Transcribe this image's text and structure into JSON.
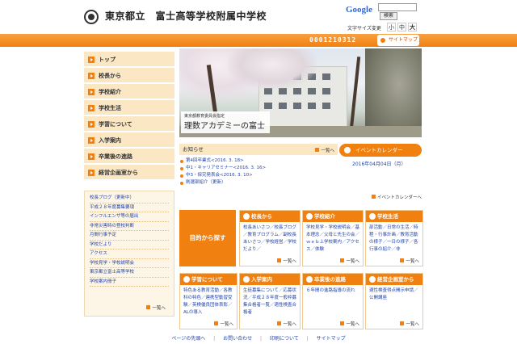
{
  "header": {
    "school_name": "東京都立　富士高等学校附属中学校",
    "google_label": "Google",
    "search_button": "検索",
    "fontsize_label": "文字サイズ変更",
    "fontsize_small": "小",
    "fontsize_mid": "中",
    "fontsize_big": "大"
  },
  "bar": {
    "counter": "0001210312",
    "sitemap": "サイトマップ"
  },
  "leftnav": {
    "items": [
      {
        "label": "トップ"
      },
      {
        "label": "校長から"
      },
      {
        "label": "学校紹介"
      },
      {
        "label": "学校生活"
      },
      {
        "label": "学習について"
      },
      {
        "label": "入学案内"
      },
      {
        "label": "卒業後の進路"
      },
      {
        "label": "経営企画室から"
      }
    ],
    "sublinks": [
      {
        "label": "校長ブログ（更新中）"
      },
      {
        "label": "平成２８年度募集要項"
      },
      {
        "label": "インフルエンザ等の届出"
      },
      {
        "label": "非常災害時の登校判断"
      },
      {
        "label": "月間行事予定"
      },
      {
        "label": "学校だより"
      },
      {
        "label": "アクセス"
      },
      {
        "label": "学校見学・学校説明会"
      },
      {
        "label": "東京都立富士高等学校"
      },
      {
        "label": "学校案内冊子"
      }
    ],
    "more": "一覧へ"
  },
  "hero": {
    "caption_small": "東京都教育委員会指定",
    "caption_big": "理数アカデミーの富士"
  },
  "news": {
    "title": "お知らせ",
    "more": "一覧へ",
    "items": [
      {
        "label": "第4回卒業式<2016. 3. 18>"
      },
      {
        "label": "中1・キャリアセミナー<2016. 3. 16>"
      },
      {
        "label": "中3・探究発表会<2016. 3. 10>"
      },
      {
        "label": "刷選部紹介（更新）"
      }
    ]
  },
  "event": {
    "button": "イベントカレンダー",
    "date": "2016年04月04日（月）",
    "more": "イベントカレンダーへ"
  },
  "grid": {
    "purpose": "目的から探す",
    "cards": [
      {
        "title": "校長から",
        "body": "校長あいさつ／校長ブログ／教育プログラム／副校長あいさつ／学校経営／学校だより／",
        "more": "一覧へ"
      },
      {
        "title": "学校紹介",
        "body": "学校見学・学校説明会／基本理念／父母と先生の会／ｗｅｂ上学校案内／アクセス／体験",
        "more": "一覧へ"
      },
      {
        "title": "学校生活",
        "body": "部活動／日常の生活／時程・行事計画／教育活動の様子／一日の様子／各行事の紹介／非",
        "more": "一覧へ"
      },
      {
        "title": "学習について",
        "body": "特色ある教育活動／各教科の特色／連携型動習受験／英検優良団体表彰／ALの導入",
        "more": "一覧へ"
      },
      {
        "title": "入学案内",
        "body": "生徒募集について／応募状況／平成２８年度一般枠募集合格者一覧／適性検査合格者",
        "more": "一覧へ"
      },
      {
        "title": "卒業後の進路",
        "body": "６年間の進路指導の流れ",
        "more": "一覧へ"
      },
      {
        "title": "経営企画室から",
        "body": "適性検査得点開示申請／公開講座",
        "more": "一覧へ"
      }
    ]
  },
  "footer": {
    "links": [
      "ページの先頭へ",
      "お問い合わせ",
      "印刷について",
      "サイトマップ"
    ],
    "separator": "|"
  },
  "colors": {
    "accent": "#f08010",
    "link": "#2244aa",
    "nav_bg": "#fbe7c4"
  }
}
